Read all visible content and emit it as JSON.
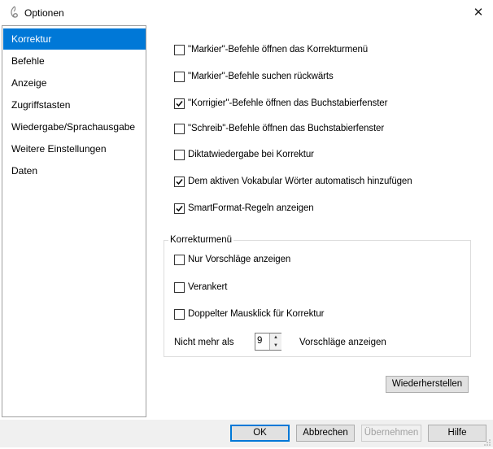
{
  "window": {
    "title": "Optionen",
    "close_glyph": "✕"
  },
  "sidebar": {
    "items": [
      {
        "label": "Korrektur",
        "active": true
      },
      {
        "label": "Befehle",
        "active": false
      },
      {
        "label": "Anzeige",
        "active": false
      },
      {
        "label": "Zugriffstasten",
        "active": false
      },
      {
        "label": "Wiedergabe/Sprachausgabe",
        "active": false
      },
      {
        "label": "Weitere Einstellungen",
        "active": false
      },
      {
        "label": "Daten",
        "active": false
      }
    ]
  },
  "options": [
    {
      "label": "\"Markier\"-Befehle öffnen das Korrekturmenü",
      "checked": false
    },
    {
      "label": "\"Markier\"-Befehle suchen rückwärts",
      "checked": false
    },
    {
      "label": "\"Korrigier\"-Befehle öffnen das Buchstabierfenster",
      "checked": true
    },
    {
      "label": "\"Schreib\"-Befehle öffnen das Buchstabierfenster",
      "checked": false
    },
    {
      "label": "Diktatwiedergabe bei Korrektur",
      "checked": false
    },
    {
      "label": "Dem aktiven Vokabular Wörter automatisch hinzufügen",
      "checked": true
    },
    {
      "label": "SmartFormat-Regeln anzeigen",
      "checked": true
    }
  ],
  "group": {
    "label": "Korrekturmenü",
    "options": [
      {
        "label": "Nur Vorschläge anzeigen",
        "checked": false
      },
      {
        "label": "Verankert",
        "checked": false
      },
      {
        "label": "Doppelter Mausklick für Korrektur",
        "checked": false
      }
    ],
    "spinner": {
      "prefix": "Nicht mehr als",
      "value": "9",
      "suffix": "Vorschläge anzeigen"
    }
  },
  "buttons": {
    "restore": "Wiederherstellen",
    "ok": "OK",
    "cancel": "Abbrechen",
    "apply": "Übernehmen",
    "help": "Hilfe"
  },
  "colors": {
    "accent": "#0078d7",
    "footer_bg": "#f0f0f0"
  }
}
